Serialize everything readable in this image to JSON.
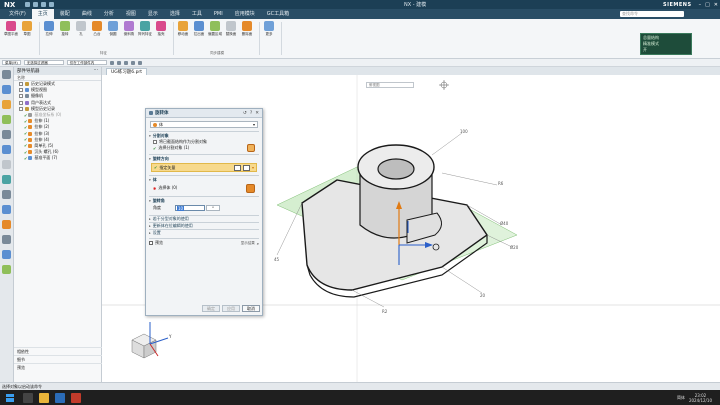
{
  "app": {
    "logo": "NX",
    "window_title": "NX - 建模",
    "brand": "SIEMENS"
  },
  "menu": {
    "tabs": [
      "文件(F)",
      "主页",
      "装配",
      "曲线",
      "分析",
      "视图",
      "显示",
      "选择",
      "工具",
      "PMI",
      "应用模块",
      "GC工具箱"
    ],
    "active_index": 1,
    "search_placeholder": "查找命令"
  },
  "ribbon": {
    "groups": [
      {
        "label": "",
        "buttons": [
          "草图平面",
          "草图"
        ]
      },
      {
        "label": "特征",
        "buttons": [
          "拉伸",
          "旋转",
          "孔",
          "凸台",
          "倒圆",
          "倒斜角",
          "阵列特征",
          "抽壳"
        ]
      },
      {
        "label": "同步建模",
        "buttons": [
          "移动面",
          "拉出面",
          "偏置区域",
          "替换面",
          "删除面"
        ]
      },
      {
        "label": "",
        "buttons": [
          "更多"
        ]
      }
    ],
    "mini_panel": [
      "总量结构",
      "精准模式",
      "开"
    ]
  },
  "cmdrow": {
    "menu_label": "菜单(M)",
    "filter": "无选择过滤器",
    "scope": "仅在工作部件内"
  },
  "navigator": {
    "title": "部件导航器",
    "column": "名称",
    "rows": [
      {
        "label": "历史记录模式",
        "icon": "history",
        "indent": 1
      },
      {
        "label": "模型视图",
        "icon": "view",
        "indent": 1
      },
      {
        "label": "摄像机",
        "icon": "camera",
        "indent": 1
      },
      {
        "label": "用户表达式",
        "icon": "expr",
        "indent": 1
      },
      {
        "label": "模型历史记录",
        "icon": "history",
        "indent": 1
      },
      {
        "label": "基准坐标系 (0)",
        "icon": "csys",
        "indent": 2,
        "dim": true
      },
      {
        "label": "拉伸 (1)",
        "icon": "extrude",
        "indent": 2
      },
      {
        "label": "拉伸 (2)",
        "icon": "extrude",
        "indent": 2
      },
      {
        "label": "拉伸 (3)",
        "icon": "extrude",
        "indent": 2
      },
      {
        "label": "拉伸 (4)",
        "icon": "extrude",
        "indent": 2
      },
      {
        "label": "简单孔 (5)",
        "icon": "hole",
        "indent": 2
      },
      {
        "label": "沉头 螺孔 (6)",
        "icon": "hole",
        "indent": 2
      },
      {
        "label": "基准平面 (7)",
        "icon": "plane",
        "indent": 2
      }
    ],
    "bottom": [
      "相依性",
      "细节",
      "预览"
    ]
  },
  "document": {
    "tab": "UG练习题6.prt"
  },
  "viewport": {
    "view_select": "俯视图",
    "dims": [
      "100",
      "R6",
      "Ø40",
      "Ø20",
      "45",
      "R2",
      "20"
    ]
  },
  "dialog": {
    "title": "旋转体",
    "type_value": "体",
    "sections": {
      "split_object": {
        "title": "分割对象",
        "checkbox_label": "将已截面结构作为分割对象",
        "select_label": "选择分割对象 (1)"
      },
      "direction": {
        "title": "旋转方向",
        "vector_label": "指定矢量"
      },
      "body": {
        "title": "体",
        "select_label": "选择体 (0)"
      },
      "angle": {
        "title": "旋转角",
        "label": "角度",
        "value": "10",
        "unit": "°"
      }
    },
    "collapsed": [
      "若干分型对象的使用",
      "更新体在位编辑的使用",
      "设置"
    ],
    "preview_label": "预览",
    "show_result": "显示结果",
    "buttons": {
      "ok": "确定",
      "apply": "应用",
      "cancel": "取消"
    }
  },
  "status": {
    "text": "选择对象以启动该命令"
  },
  "taskbar": {
    "time": "23:02",
    "date": "2024/12/10",
    "lang": "简体"
  }
}
